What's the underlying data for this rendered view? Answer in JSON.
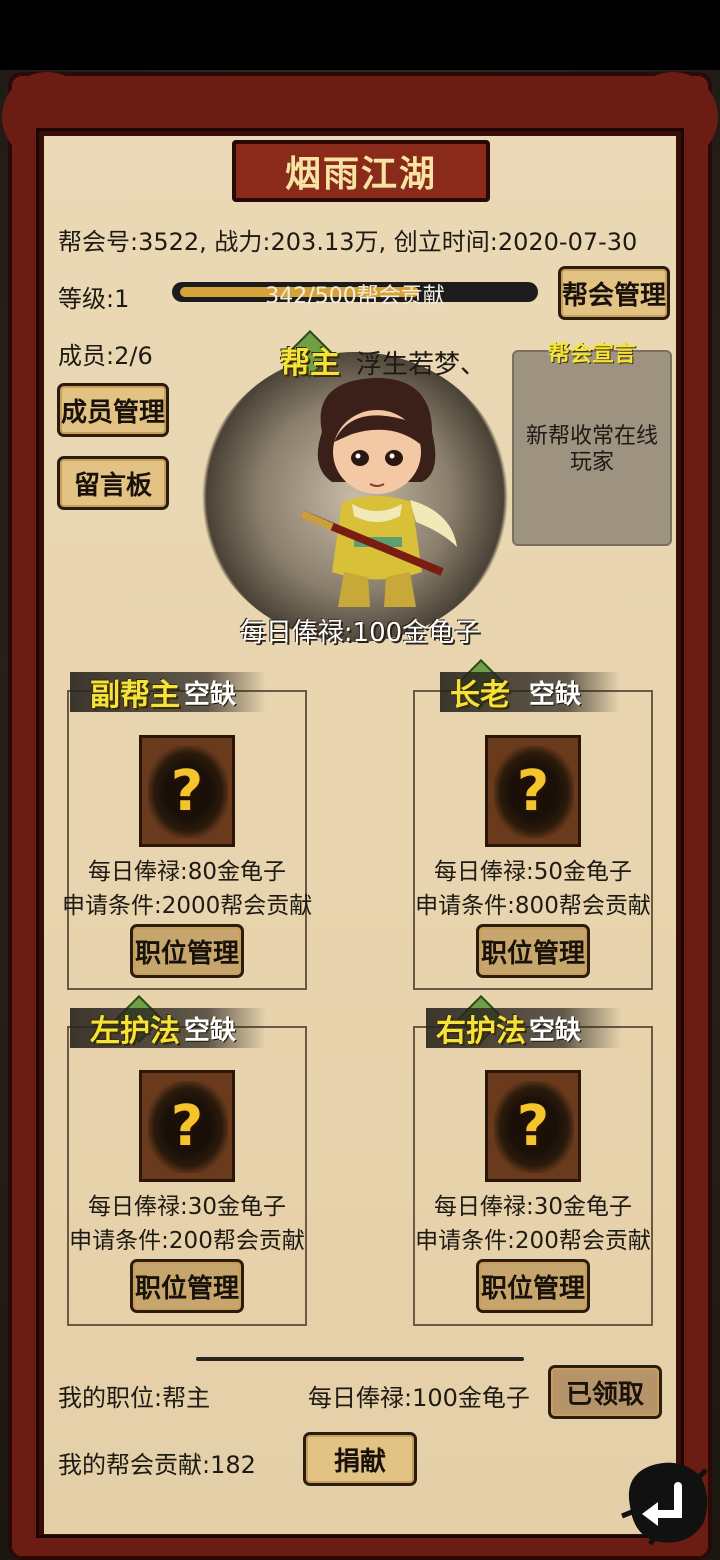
{
  "guild": {
    "name": "烟雨江湖",
    "info_line": "帮会号:3522, 战力:203.13万, 创立时间:2020-07-30",
    "level_label": "等级:1",
    "progress_label": "342/500帮会贡献",
    "progress_fraction": 0.684,
    "members_label": "成员:2/6"
  },
  "buttons": {
    "guild_manage": "帮会管理",
    "member_manage": "成员管理",
    "message_board": "留言板",
    "claimed": "已领取",
    "donate": "捐献"
  },
  "leader": {
    "tag": "帮主",
    "name": "浮生若梦、",
    "daily_salary": "每日俸禄:100金龟子"
  },
  "declaration": {
    "title": "帮会宣言",
    "text": "新帮收常在线玩家"
  },
  "positions": [
    {
      "title": "副帮主",
      "status": "空缺",
      "salary": "每日俸禄:80金龟子",
      "requirement": "申请条件:2000帮会贡献",
      "button": "职位管理"
    },
    {
      "title": "长老",
      "status": "空缺",
      "salary": "每日俸禄:50金龟子",
      "requirement": "申请条件:800帮会贡献",
      "button": "职位管理"
    },
    {
      "title": "左护法",
      "status": "空缺",
      "salary": "每日俸禄:30金龟子",
      "requirement": "申请条件:200帮会贡献",
      "button": "职位管理"
    },
    {
      "title": "右护法",
      "status": "空缺",
      "salary": "每日俸禄:30金龟子",
      "requirement": "申请条件:200帮会贡献",
      "button": "职位管理"
    }
  ],
  "footer": {
    "my_position": "我的职位:帮主",
    "my_salary": "每日俸禄:100金龟子",
    "my_contribution": "我的帮会贡献:182"
  },
  "icons": {
    "question": "?",
    "back": "return-arrow-icon"
  },
  "colors": {
    "frame": "#6b1d14",
    "paper": "#e8d4ae",
    "title_gold": "#f7e3a3",
    "rank_yellow": "#f3e33a",
    "button": "#e2c384"
  }
}
